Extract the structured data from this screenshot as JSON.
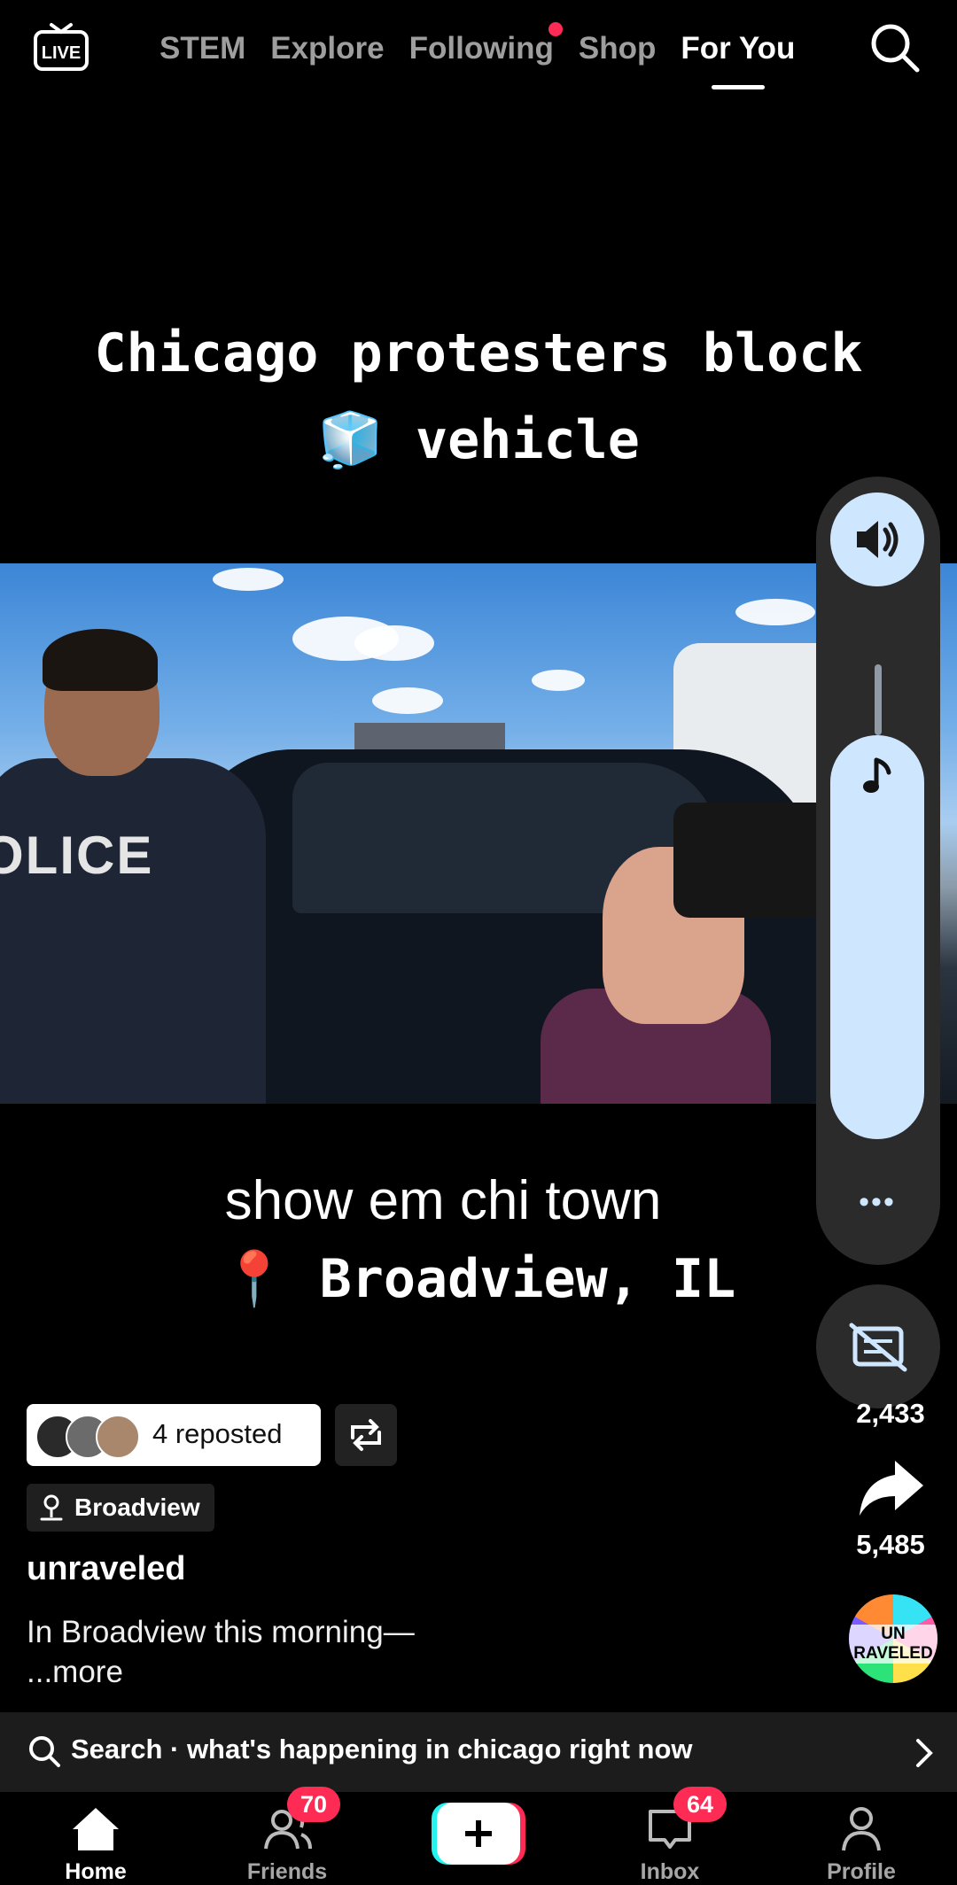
{
  "top_nav": {
    "live_label": "LIVE",
    "tabs": [
      {
        "label": "STEM"
      },
      {
        "label": "Explore"
      },
      {
        "label": "Following"
      },
      {
        "label": "Shop"
      },
      {
        "label": "For You"
      }
    ],
    "active_tab": "For You"
  },
  "video": {
    "headline_line1": "Chicago protesters block",
    "headline_line2": "🧊 vehicle",
    "frame_text": "OLICE",
    "caption": "show em chi town",
    "location_overlay": "📍 Broadview, IL"
  },
  "right_rail": {
    "more_dots": "•••",
    "count_under_cc": "2,433",
    "share_count": "5,485",
    "avatar_text": "UN RAVELED"
  },
  "post": {
    "repost_text": "4 reposted",
    "place_label": "Broadview",
    "username": "unraveled",
    "description": "In Broadview this morning—",
    "more_label": "...more"
  },
  "search_bar": {
    "text": "Search · what's happening in chicago right now"
  },
  "bottom_nav": {
    "items": [
      {
        "label": "Home"
      },
      {
        "label": "Friends",
        "badge": "70"
      },
      {
        "label": "Inbox",
        "badge": "64"
      },
      {
        "label": "Profile"
      }
    ]
  },
  "colors": {
    "accent": "#fe2c55",
    "volume_fill": "#cfe6ff",
    "panel": "#2b2b2b"
  }
}
